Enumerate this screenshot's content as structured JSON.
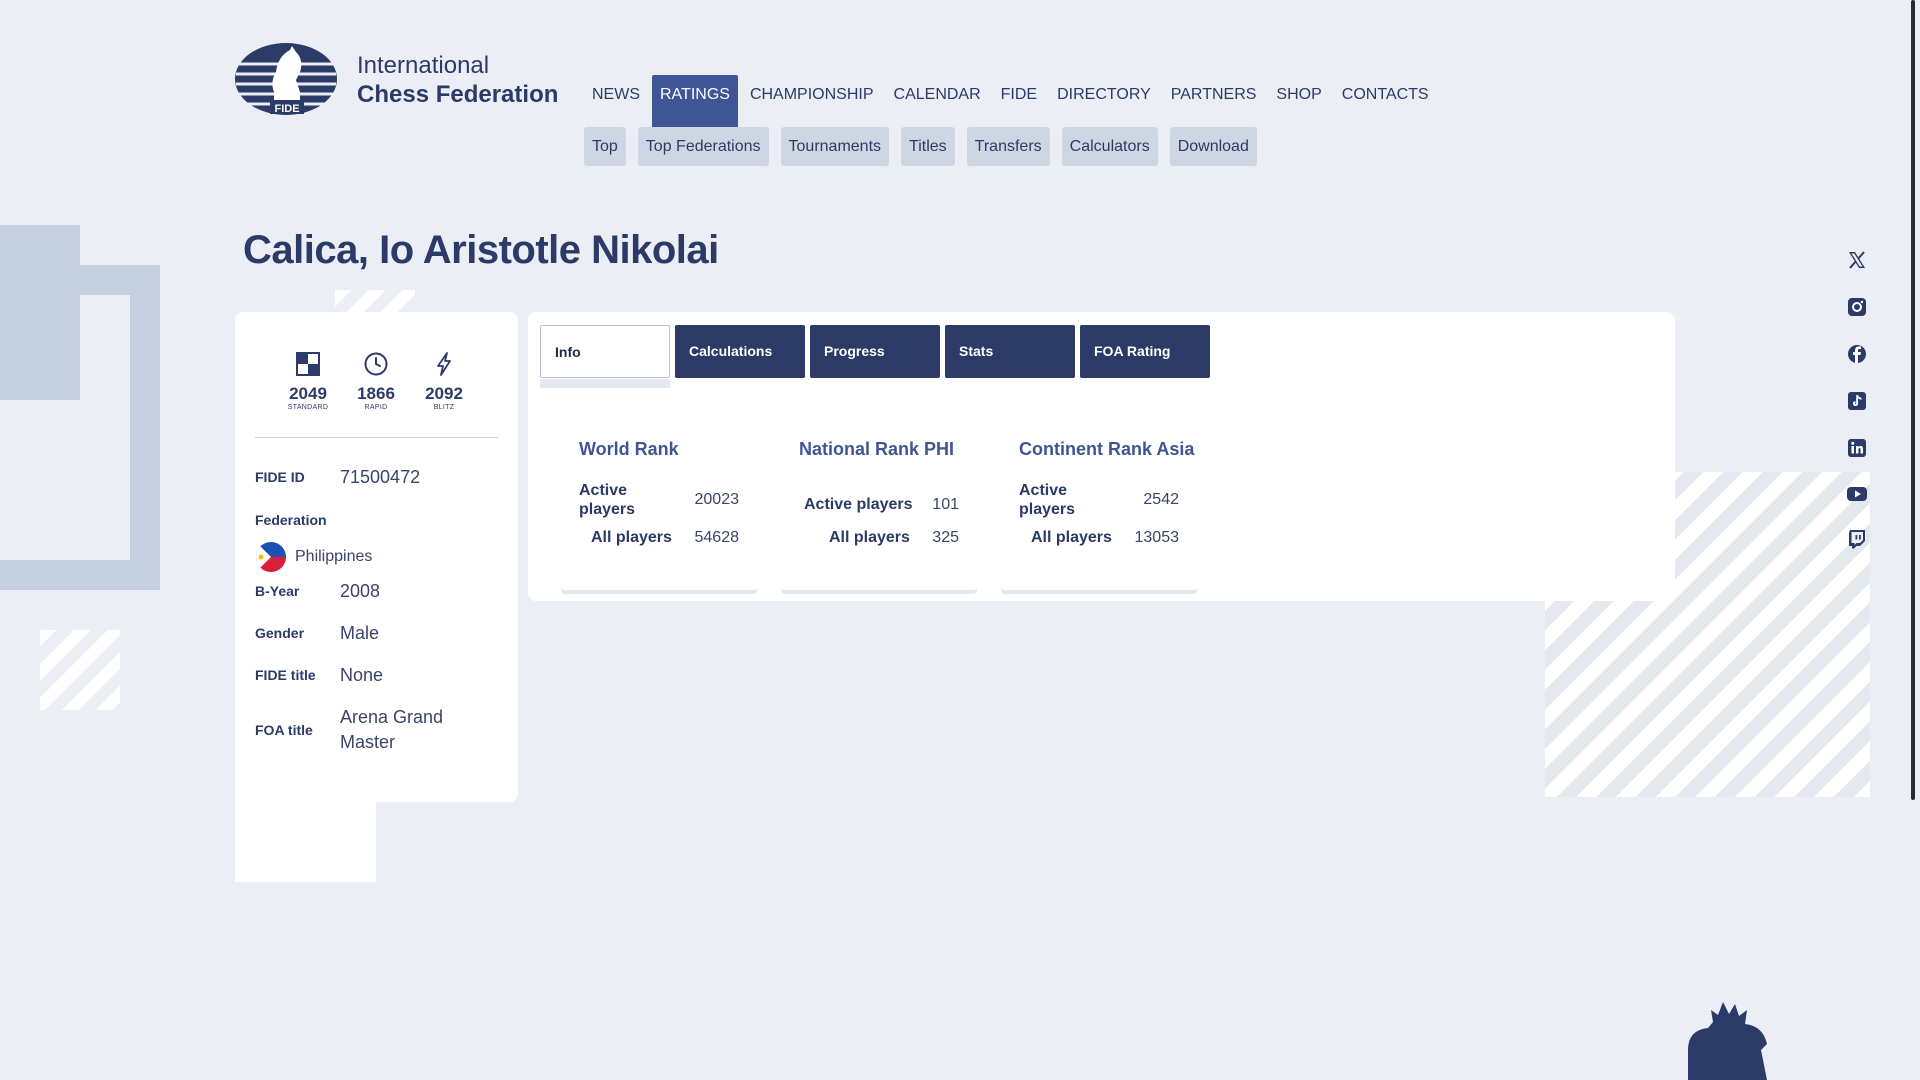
{
  "header": {
    "logo_abbr": "FIDE",
    "logo_line1": "International",
    "logo_line2": "Chess Federation"
  },
  "main_nav": [
    "NEWS",
    "RATINGS",
    "CHAMPIONSHIP",
    "CALENDAR",
    "FIDE",
    "DIRECTORY",
    "PARTNERS",
    "SHOP",
    "CONTACTS"
  ],
  "sub_nav": [
    "Top",
    "Top Federations",
    "Tournaments",
    "Titles",
    "Transfers",
    "Calculators",
    "Download"
  ],
  "player": {
    "name": "Calica, Io Aristotle Nikolai",
    "ratings": {
      "standard": {
        "value": "2049",
        "label": "STANDARD"
      },
      "rapid": {
        "value": "1866",
        "label": "RAPID"
      },
      "blitz": {
        "value": "2092",
        "label": "BLITZ"
      }
    },
    "fide_id_label": "FIDE ID",
    "fide_id": "71500472",
    "federation_label": "Federation",
    "federation": "Philippines",
    "byear_label": "B-Year",
    "byear": "2008",
    "gender_label": "Gender",
    "gender": "Male",
    "fide_title_label": "FIDE title",
    "fide_title": "None",
    "foa_title_label": "FOA title",
    "foa_title": "Arena Grand Master"
  },
  "tabs": [
    "Info",
    "Calculations",
    "Progress",
    "Stats",
    "FOA Rating"
  ],
  "ranks": {
    "world": {
      "title": "World Rank",
      "active_label": "Active players",
      "active": "20023",
      "all_label": "All players",
      "all": "54628"
    },
    "national": {
      "title": "National Rank PHI",
      "active_label": "Active players",
      "active": "101",
      "all_label": "All players",
      "all": "325"
    },
    "continent": {
      "title": "Continent Rank Asia",
      "active_label": "Active players",
      "active": "2542",
      "all_label": "All players",
      "all": "13053"
    }
  },
  "social_icons": [
    "x-icon",
    "instagram-icon",
    "facebook-icon",
    "tiktok-icon",
    "linkedin-icon",
    "youtube-icon",
    "twitch-icon"
  ],
  "colors": {
    "brand": "#2b3a67",
    "accent": "#3f5595",
    "background": "#ebeef4"
  }
}
